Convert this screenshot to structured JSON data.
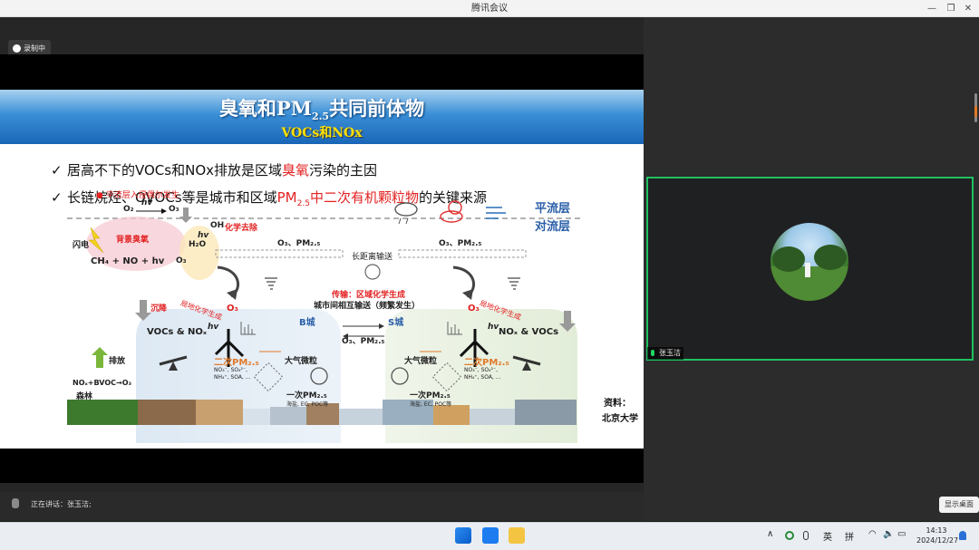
{
  "window": {
    "title": "腾讯会议",
    "min": "—",
    "restore": "❐",
    "close": "✕"
  },
  "recording": {
    "label": "录制中"
  },
  "slide": {
    "title": "臭氧和PM",
    "title_sub": "2.5",
    "title_tail": "共同前体物",
    "subtitle": "VOCs和NOx",
    "bullet1": {
      "prefix": "居高不下的VOCs和NOx排放是区域",
      "highlight": "臭氧",
      "suffix": "污染的主因"
    },
    "bullet2": {
      "prefix": "长链烷烃、OVOCs等是城市和区域",
      "highlight_pm": "PM",
      "highlight_sub": "2.5",
      "highlight": "中二次有机颗粒物",
      "suffix": "的关键来源"
    },
    "diagram": {
      "strat_intrusion": "平流层入侵偶尔发生",
      "o2": "O₂",
      "hv": "hv",
      "o3": "O₃",
      "oh": "OH",
      "chem_removal": "化学去除",
      "h2o": "H₂O",
      "lightning": "闪电",
      "bg_ozone": "背景臭氧",
      "ch4": "CH₄ + NO + hv",
      "o3b": "O₃",
      "o3pm_left": "O₃、PM₂.₅",
      "long_range": "长距离输送",
      "o3pm_right": "O₃、PM₂.₅",
      "stratosphere": "平流层",
      "troposphere": "对流层",
      "transport": "传输：区域化学生成",
      "city_exchange": "城市间相互输送（频繁发生）",
      "deposition": "沉降",
      "local_gen_left": "局地化学生成",
      "o3_left": "O₃",
      "vocs_left": "VOCs & NOₓ",
      "hv_left": "hv",
      "b_city": "B城",
      "s_city": "S城",
      "o3pm_mid": "O₃、PM₂.₅",
      "o3_right": "O₃",
      "local_gen_right": "局地化学生成",
      "vocs_right": "NOₓ & VOCs",
      "hv_right": "hv",
      "secondary_left": "二次PM₂.₅",
      "secondary_left_list": "NO₃⁻, SO₄²⁻, NH₄⁺, SOA, ...",
      "atm_left": "大气微粒",
      "primary_left": "一次PM₂.₅",
      "primary_left_list": "海盐, EC, POC等",
      "emission": "排放",
      "forest_eq": "NOₓ+BVOC→O₃",
      "forest": "森林",
      "atm_right": "大气微粒",
      "secondary_right": "二次PM₂.₅",
      "secondary_right_list": "NO₃⁻, SO₄²⁻, NH₄⁺, SOA, ...",
      "primary_right": "一次PM₂.₅",
      "primary_right_list": "海盐, EC, POC等",
      "source_label": "资料：",
      "source_name": "北京大学"
    }
  },
  "participant": {
    "name": "张玉洁"
  },
  "status": {
    "speaking": "正在讲话：张玉洁;"
  },
  "show_desktop": "显示桌面",
  "tray": {
    "caret": "∧",
    "lang1": "英",
    "lang2": "拼",
    "wifi": "◠",
    "volume": "🔈",
    "battery": "▭",
    "time": "14:13",
    "date": "2024/12/27"
  },
  "colors": {
    "accent_green": "#20c060",
    "highlight_red": "#e32222",
    "banner_blue": "#1a66b8",
    "banner_yellow": "#ffe000"
  }
}
